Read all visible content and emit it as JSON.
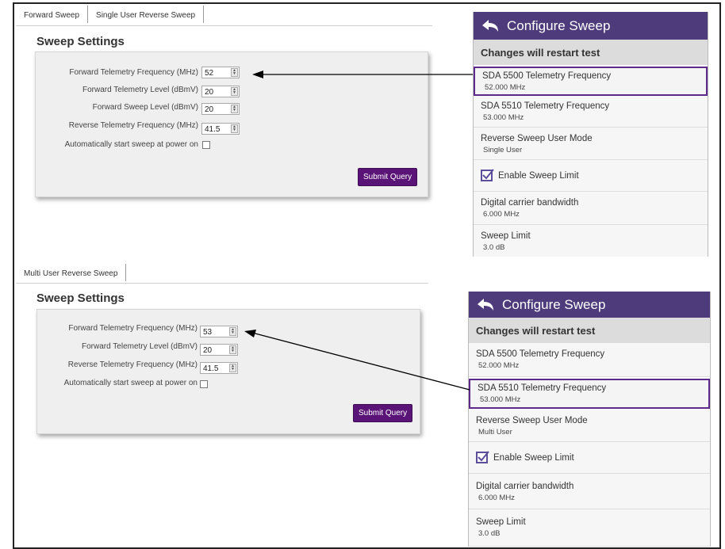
{
  "top_panel": {
    "tabs": [
      "Forward Sweep",
      "Single User Reverse Sweep"
    ],
    "section_title": "Sweep Settings",
    "fields": [
      {
        "label": "Forward Telemetry Frequency (MHz)",
        "value": "52"
      },
      {
        "label": "Forward Telemetry Level (dBmV)",
        "value": "20"
      },
      {
        "label": "Forward Sweep Level (dBmV)",
        "value": "20"
      },
      {
        "label": "Reverse Telemetry Frequency (MHz)",
        "value": "41.5"
      }
    ],
    "autostart_label": "Automatically start sweep at power on",
    "submit_label": "Submit Query"
  },
  "bottom_panel": {
    "tabs": [
      "Multi User Reverse Sweep"
    ],
    "section_title": "Sweep Settings",
    "fields": [
      {
        "label": "Forward Telemetry Frequency (MHz)",
        "value": "53"
      },
      {
        "label": "Forward Telemetry Level (dBmV)",
        "value": "20"
      },
      {
        "label": "Reverse Telemetry Frequency (MHz)",
        "value": "41.5"
      }
    ],
    "autostart_label": "Automatically start sweep at power on",
    "submit_label": "Submit Query"
  },
  "device_top": {
    "title": "Configure Sweep",
    "subtitle": "Changes will restart test",
    "items": [
      {
        "title": "SDA 5500 Telemetry Frequency",
        "value": "52.000 MHz"
      },
      {
        "title": "SDA 5510 Telemetry Frequency",
        "value": "53.000 MHz"
      },
      {
        "title": "Reverse Sweep User Mode",
        "value": "Single User"
      },
      {
        "title": "Enable Sweep Limit"
      },
      {
        "title": "Digital carrier bandwidth",
        "value": "6.000 MHz"
      },
      {
        "title": "Sweep Limit",
        "value": "3.0 dB"
      }
    ]
  },
  "device_bottom": {
    "title": "Configure Sweep",
    "subtitle": "Changes will restart test",
    "items": [
      {
        "title": "SDA 5500 Telemetry Frequency",
        "value": "52.000 MHz"
      },
      {
        "title": "SDA 5510 Telemetry Frequency",
        "value": "53.000 MHz"
      },
      {
        "title": "Reverse Sweep User Mode",
        "value": "Multi User"
      },
      {
        "title": "Enable Sweep Limit"
      },
      {
        "title": "Digital carrier bandwidth",
        "value": "6.000 MHz"
      },
      {
        "title": "Sweep Limit",
        "value": "3.0 dB"
      }
    ]
  },
  "colors": {
    "header_purple": "#4e3b7c",
    "submit_purple": "#5a1478",
    "selected_border": "#5c2a8a"
  }
}
